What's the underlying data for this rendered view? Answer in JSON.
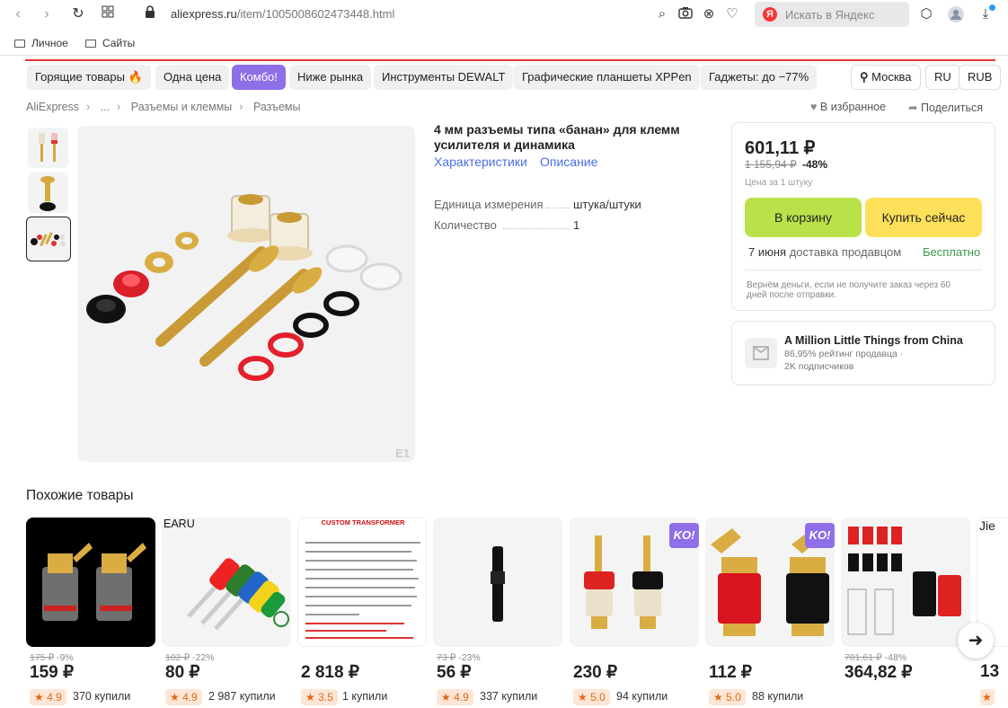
{
  "browser": {
    "url_host": "aliexpress.ru",
    "url_path": "/item/1005008602473448.html",
    "search_placeholder": "Искать в Яндекс",
    "yandex_letter": "Я"
  },
  "bookmarks": [
    "Личное",
    "Сайты"
  ],
  "chips": [
    "Горящие товары 🔥",
    "Одна цена",
    "Комбо!",
    "Ниже рынка",
    "Инструменты DEWALT",
    "Графические планшеты XPPen",
    "Гаджеты: до −77%"
  ],
  "region": {
    "city": "Москва",
    "lang": "RU",
    "currency": "RUB"
  },
  "breadcrumbs": [
    "AliExpress",
    "...",
    "Разъемы и клеммы",
    "Разъемы"
  ],
  "actions": {
    "favorite": "В избранное",
    "share": "Поделиться"
  },
  "product": {
    "title": "4 мм разъемы типа «банан» для клемм усилителя и динамика",
    "tabs": [
      "Характеристики",
      "Описание"
    ],
    "props": [
      {
        "name": "Единица измерения",
        "value": "штука/штуки"
      },
      {
        "name": "Количество",
        "value": "1"
      }
    ],
    "image_badge": "E1"
  },
  "buy": {
    "price": "601,11 ₽",
    "old_price": "1 155,94 ₽",
    "discount": "-48%",
    "unit": "Цена за 1 штуку",
    "cart_label": "В корзину",
    "buy_label": "Купить сейчас",
    "delivery_date": "7 июня",
    "delivery_text": "доставка продавцом",
    "delivery_price": "Бесплатно",
    "refund": "Вернём деньги, если не получите заказ через 60 дней после отправки.",
    "cart_color": "#b9e24a",
    "buy_color": "#fde05a"
  },
  "seller": {
    "name": "A Million Little Things from China",
    "rating": "86,95% рейтинг продавца",
    "subscribers": "2K подписчиков"
  },
  "similar": {
    "title": "Похожие товары",
    "ko_badge": "KO!",
    "items": [
      {
        "old": "175 ₽",
        "disc": "-9%",
        "price": "159 ₽",
        "rating": "4.9",
        "bought": "370 купили"
      },
      {
        "label": "EARU",
        "old": "102 ₽",
        "disc": "-22%",
        "price": "80 ₽",
        "rating": "4.9",
        "bought": "2 987 купили"
      },
      {
        "label": "CUSTOM TRANSFORMER",
        "old": "",
        "disc": "",
        "price": "2 818 ₽",
        "rating": "3.5",
        "bought": "1 купили"
      },
      {
        "old": "73 ₽",
        "disc": "-23%",
        "price": "56 ₽",
        "rating": "4.9",
        "bought": "337 купили"
      },
      {
        "old": "",
        "disc": "",
        "price": "230 ₽",
        "rating": "5.0",
        "bought": "94 купили",
        "ko": true
      },
      {
        "old": "",
        "disc": "",
        "price": "112 ₽",
        "rating": "5.0",
        "bought": "88 купили",
        "ko": true
      },
      {
        "old": "701,61 ₽",
        "disc": "-48%",
        "price": "364,82 ₽",
        "rating": "",
        "bought": ""
      },
      {
        "label": "Jie",
        "old": "",
        "disc": "",
        "price": "13",
        "rating": "",
        "bought": ""
      }
    ]
  }
}
